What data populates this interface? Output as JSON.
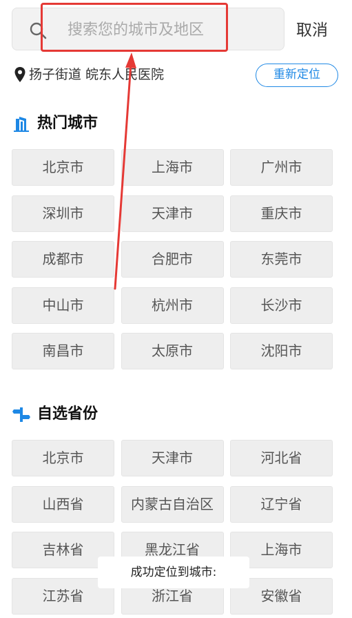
{
  "search": {
    "placeholder": "搜索您的城市及地区",
    "cancel_label": "取消"
  },
  "location": {
    "current": "扬子街道 皖东人民医院",
    "relocate_label": "重新定位"
  },
  "hot_cities": {
    "title": "热门城市",
    "items": [
      "北京市",
      "上海市",
      "广州市",
      "深圳市",
      "天津市",
      "重庆市",
      "成都市",
      "合肥市",
      "东莞市",
      "中山市",
      "杭州市",
      "长沙市",
      "南昌市",
      "太原市",
      "沈阳市"
    ]
  },
  "provinces": {
    "title": "自选省份",
    "items": [
      "北京市",
      "天津市",
      "河北省",
      "山西省",
      "内蒙古自治区",
      "辽宁省",
      "吉林省",
      "黑龙江省",
      "上海市",
      "江苏省",
      "浙江省",
      "安徽省"
    ]
  },
  "toast": {
    "text": "成功定位到城市:"
  },
  "colors": {
    "accent": "#1e88e5",
    "annotation": "#e53935"
  },
  "icons": {
    "search": "search-icon",
    "pin": "location-pin-icon",
    "hot": "building-icon",
    "province": "signpost-icon"
  }
}
